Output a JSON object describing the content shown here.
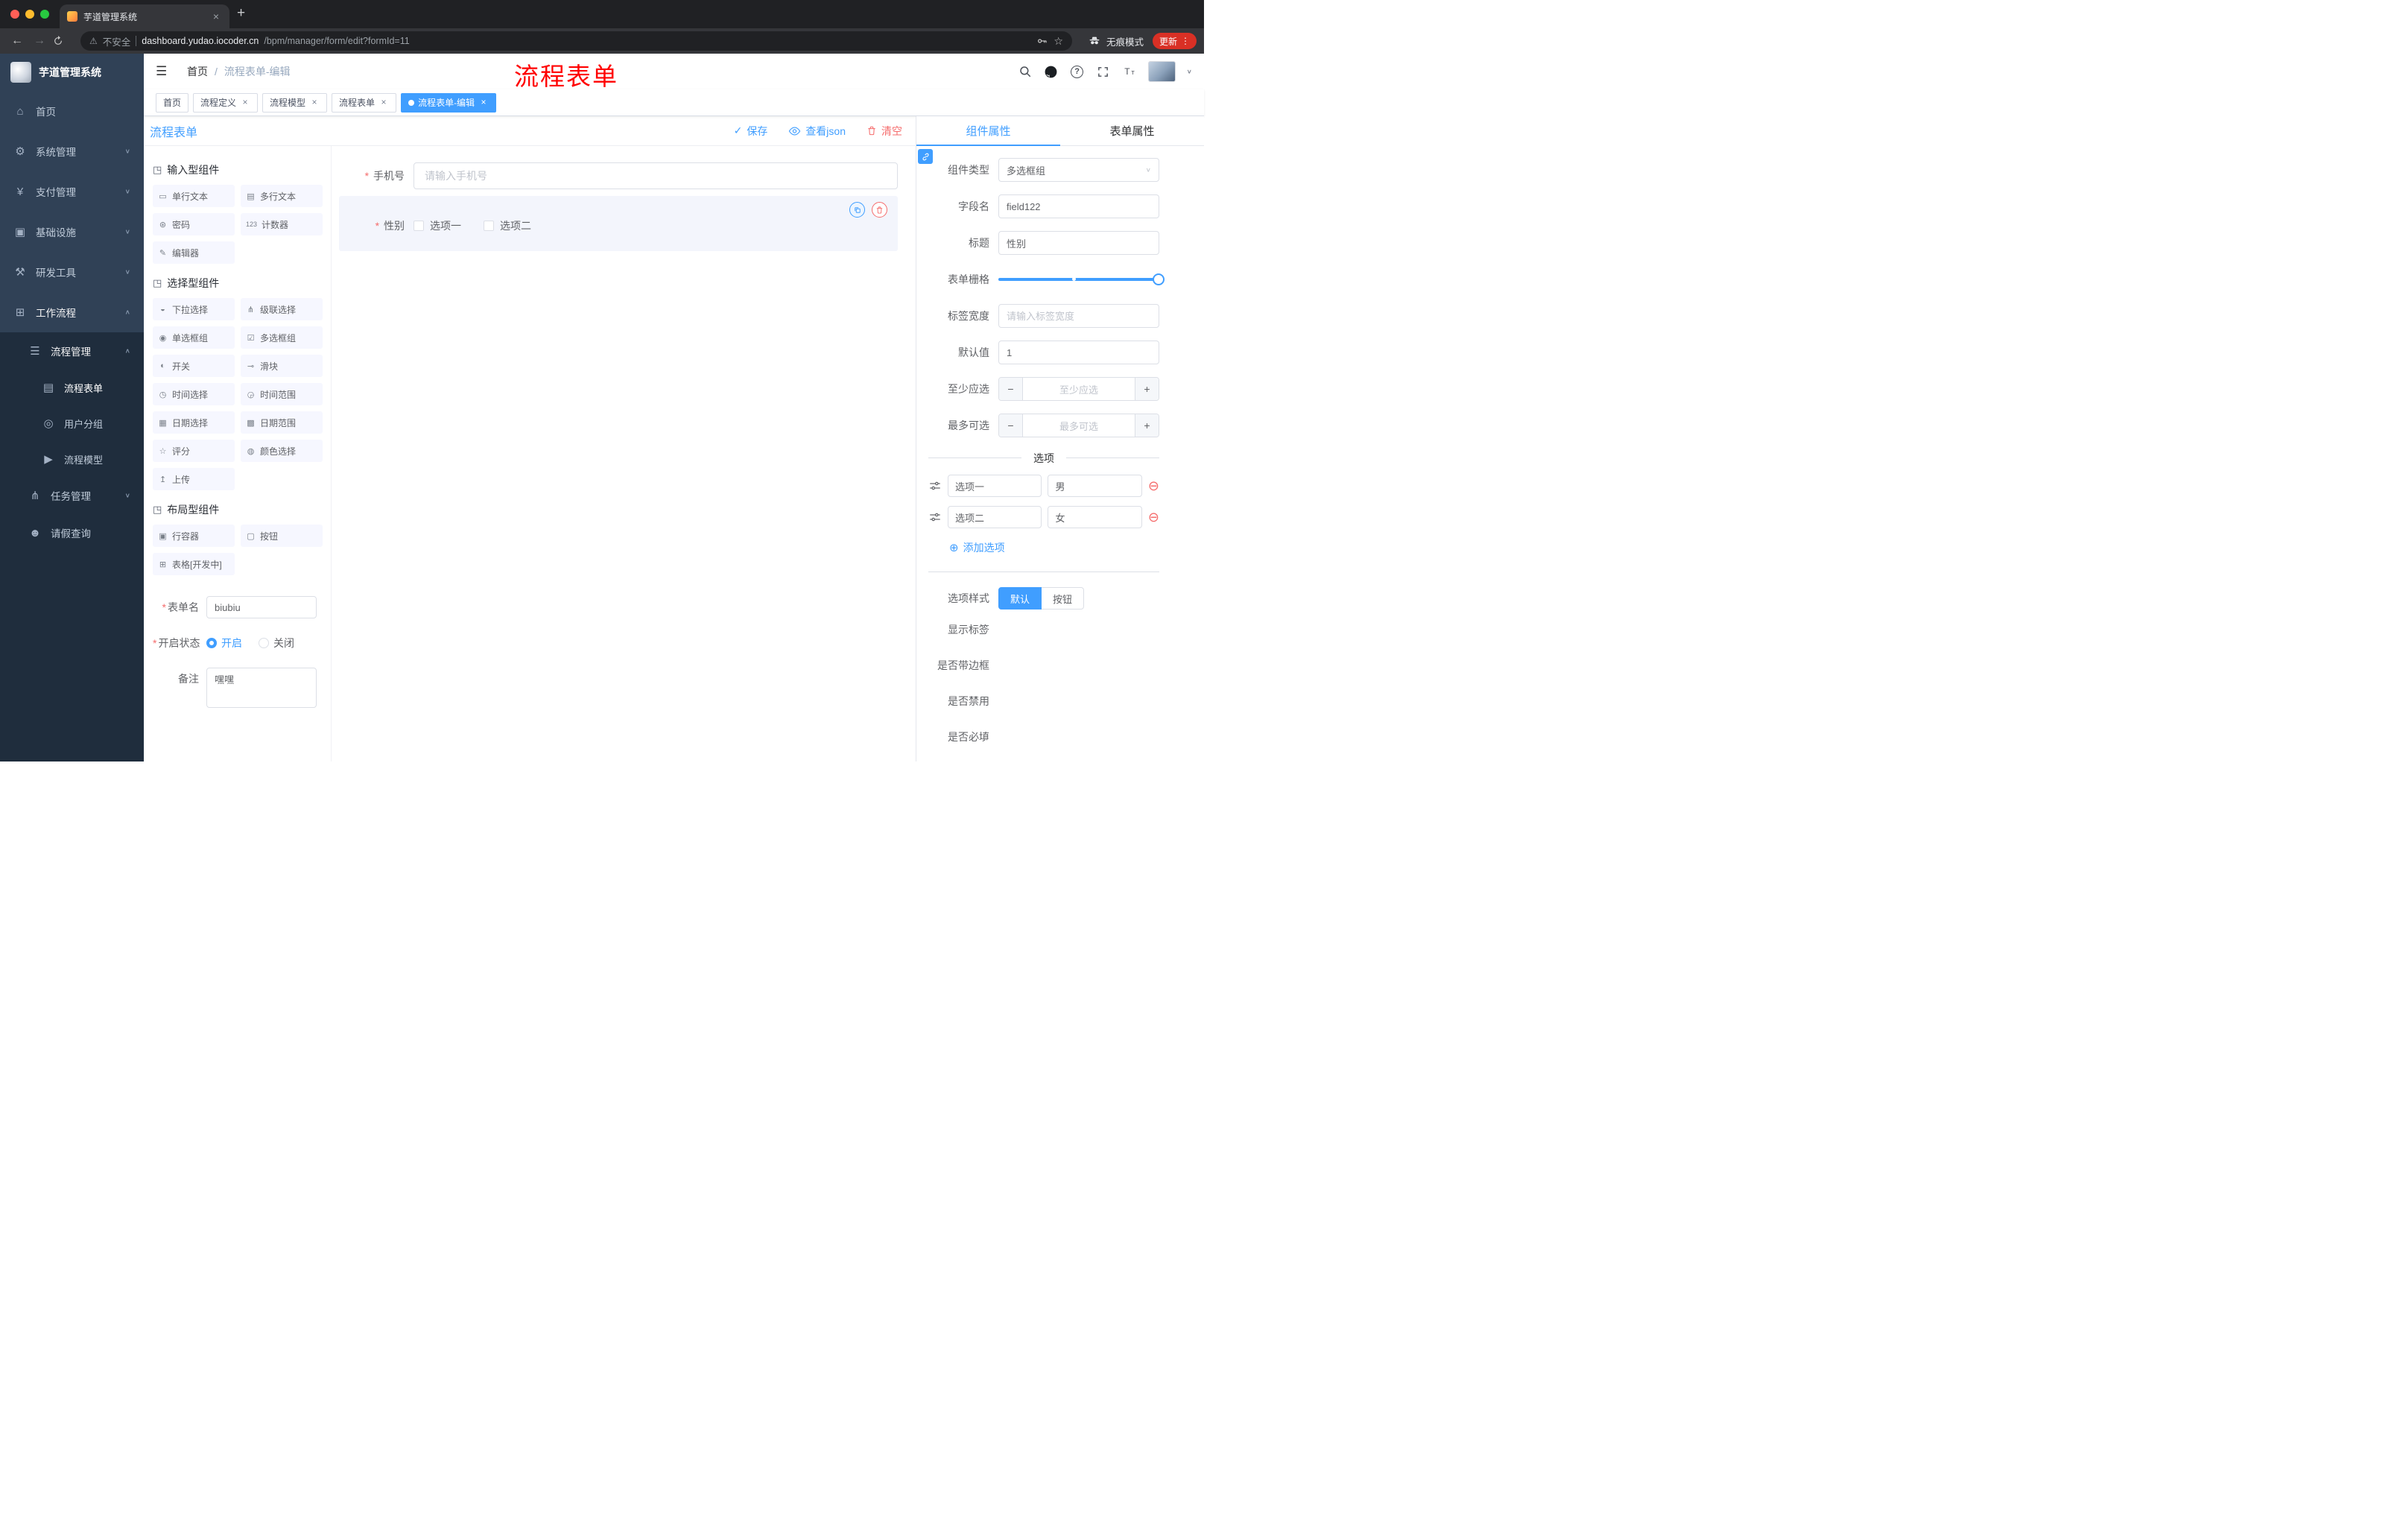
{
  "common": {
    "required_mark": "*",
    "caret_down": "∨",
    "caret_up": "∧",
    "close": "×",
    "group_glyph": "◳",
    "plus_circle": "⊕",
    "minus_circle": "⊖",
    "minus": "−",
    "plus": "+",
    "check": "✓",
    "question": "?"
  },
  "annotation": "流程表单",
  "browser": {
    "tab_title": "芋道管理系统",
    "new_tab_glyph": "+",
    "back_glyph": "←",
    "forward_glyph": "→",
    "warning_glyph": "⚠",
    "security_text": "不安全",
    "url_host": "dashboard.yudao.iocoder.cn",
    "url_path": "/bpm/manager/form/edit?formId=11",
    "star_glyph": "☆",
    "incognito_text": "无痕模式",
    "update_text": "更新",
    "menu_glyph": "⋮"
  },
  "sidebar": {
    "title": "芋道管理系统",
    "items": [
      {
        "label": "首页",
        "glyph": "⌂",
        "icon": "home-icon"
      },
      {
        "label": "系统管理",
        "glyph": "⚙",
        "icon": "system-icon"
      },
      {
        "label": "支付管理",
        "glyph": "¥",
        "icon": "payment-icon"
      },
      {
        "label": "基础设施",
        "glyph": "▣",
        "icon": "infrastructure-icon"
      },
      {
        "label": "研发工具",
        "glyph": "⚒",
        "icon": "devtools-icon"
      },
      {
        "label": "工作流程",
        "glyph": "⊞",
        "icon": "workflow-icon"
      }
    ],
    "submenu": {
      "label": "流程管理",
      "glyph": "☰",
      "items": [
        {
          "label": "流程表单",
          "glyph": "▤",
          "icon": "process-form-icon"
        },
        {
          "label": "用户分组",
          "glyph": "◎",
          "icon": "user-group-icon"
        },
        {
          "label": "流程模型",
          "glyph": "▶",
          "icon": "process-model-icon"
        }
      ]
    },
    "tail": [
      {
        "label": "任务管理",
        "glyph": "⋔",
        "icon": "task-management-icon"
      },
      {
        "label": "请假查询",
        "glyph": "☻",
        "icon": "leave-query-icon"
      }
    ]
  },
  "header": {
    "hamburger_glyph": "☰",
    "breadcrumb": {
      "home": "首页",
      "separator": "/",
      "current": "流程表单-编辑"
    }
  },
  "tags": {
    "items": [
      {
        "label": "首页"
      },
      {
        "label": "流程定义"
      },
      {
        "label": "流程模型"
      },
      {
        "label": "流程表单"
      },
      {
        "label": "流程表单-编辑"
      }
    ]
  },
  "designer": {
    "title": "流程表单",
    "save_label": "保存",
    "view_json_label": "查看json",
    "clear_label": "清空",
    "palette": {
      "groups": [
        {
          "title": "输入型组件",
          "items": [
            {
              "label": "单行文本",
              "glyph": "▭"
            },
            {
              "label": "多行文本",
              "glyph": "▤"
            },
            {
              "label": "密码",
              "glyph": "⊛"
            },
            {
              "label": "计数器",
              "glyph": "123"
            },
            {
              "label": "编辑器",
              "glyph": "✎"
            }
          ]
        },
        {
          "title": "选择型组件",
          "items": [
            {
              "label": "下拉选择",
              "glyph": "◒"
            },
            {
              "label": "级联选择",
              "glyph": "⋔"
            },
            {
              "label": "单选框组",
              "glyph": "◉"
            },
            {
              "label": "多选框组",
              "glyph": "☑"
            },
            {
              "label": "开关",
              "glyph": "◐"
            },
            {
              "label": "滑块",
              "glyph": "⊸"
            },
            {
              "label": "时间选择",
              "glyph": "◷"
            },
            {
              "label": "时间范围",
              "glyph": "◶"
            },
            {
              "label": "日期选择",
              "glyph": "▦"
            },
            {
              "label": "日期范围",
              "glyph": "▩"
            },
            {
              "label": "评分",
              "glyph": "☆"
            },
            {
              "label": "颜色选择",
              "glyph": "◍"
            },
            {
              "label": "上传",
              "glyph": "↥"
            }
          ]
        },
        {
          "title": "布局型组件",
          "items": [
            {
              "label": "行容器",
              "glyph": "▣"
            },
            {
              "label": "按钮",
              "glyph": "▢"
            },
            {
              "label": "表格[开发中]",
              "glyph": "⊞"
            }
          ]
        }
      ]
    },
    "settings": {
      "form_name_label": "表单名",
      "form_name_value": "biubiu",
      "status_label": "开启状态",
      "status_on": "开启",
      "status_off": "关闭",
      "remark_label": "备注",
      "remark_value": "嘿嘿"
    }
  },
  "canvas": {
    "phone_label": "手机号",
    "phone_placeholder": "请输入手机号",
    "gender_label": "性别",
    "gender_options": [
      "选项一",
      "选项二"
    ]
  },
  "props": {
    "tab_component": "组件属性",
    "tab_form": "表单属性",
    "component_type_label": "组件类型",
    "component_type_value": "多选框组",
    "field_name_label": "字段名",
    "field_name_value": "field122",
    "title_label": "标题",
    "title_value": "性别",
    "grid_label": "表单栅格",
    "label_width_label": "标签宽度",
    "label_width_placeholder": "请输入标签宽度",
    "default_label": "默认值",
    "default_value": "1",
    "min_label": "至少应选",
    "min_placeholder": "至少应选",
    "max_label": "最多可选",
    "max_placeholder": "最多可选",
    "options_title": "选项",
    "options": [
      {
        "label_value": "选项一",
        "value_value": "男"
      },
      {
        "label_value": "选项二",
        "value_value": "女"
      }
    ],
    "add_option_label": "添加选项",
    "style_label": "选项样式",
    "style_default": "默认",
    "style_button": "按钮",
    "show_label_label": "显示标签",
    "border_label": "是否带边框",
    "disabled_label": "是否禁用",
    "required_label": "是否必填"
  },
  "colors": {
    "primary": "#409eff",
    "danger": "#f56c6c",
    "annotation": "#ff0000"
  }
}
